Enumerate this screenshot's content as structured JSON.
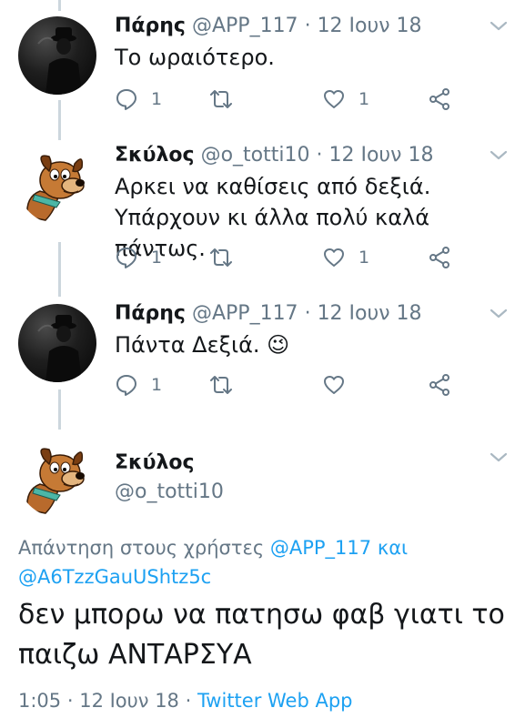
{
  "thread": [
    {
      "name": "Πάρης",
      "handle": "@APP_117",
      "separator": "·",
      "date": "12 Ιουν 18",
      "text": "Το ωραιότερο.",
      "avatar_icon": "noir-man-avatar",
      "reply_count": "1",
      "retweet_count": "",
      "like_count": "1"
    },
    {
      "name": "Σκύλος",
      "handle": "@o_totti10",
      "separator": "·",
      "date": "12 Ιουν 18",
      "text": "Αρκει να καθίσεις από δεξιά. Υπάρχουν κι άλλα πολύ καλά πάντως.",
      "avatar_icon": "cartoon-dog-avatar",
      "reply_count": "1",
      "retweet_count": "",
      "like_count": "1"
    },
    {
      "name": "Πάρης",
      "handle": "@APP_117",
      "separator": "·",
      "date": "12 Ιουν 18",
      "text": "Πάντα Δεξιά. 😉",
      "avatar_icon": "noir-man-avatar",
      "reply_count": "1",
      "retweet_count": "",
      "like_count": ""
    }
  ],
  "main_tweet": {
    "name": "Σκύλος",
    "handle": "@o_totti10",
    "reply_prefix": "Απάντηση στους χρήστες ",
    "mention1": "@APP_117",
    "conj": " και ",
    "mention2": "@A6TzzGauUShtz5c",
    "text": "δεν μπορω να πατησω φαβ γιατι το παιζω ΑΝΤΑΡΣΥΑ",
    "time": "1:05",
    "sep": " · ",
    "date": "12 Ιουν 18",
    "source": "Twitter Web App"
  },
  "colors": {
    "text": "#14171a",
    "muted": "#657786",
    "link": "#1da1f2",
    "thread_line": "#ccd6dd"
  }
}
